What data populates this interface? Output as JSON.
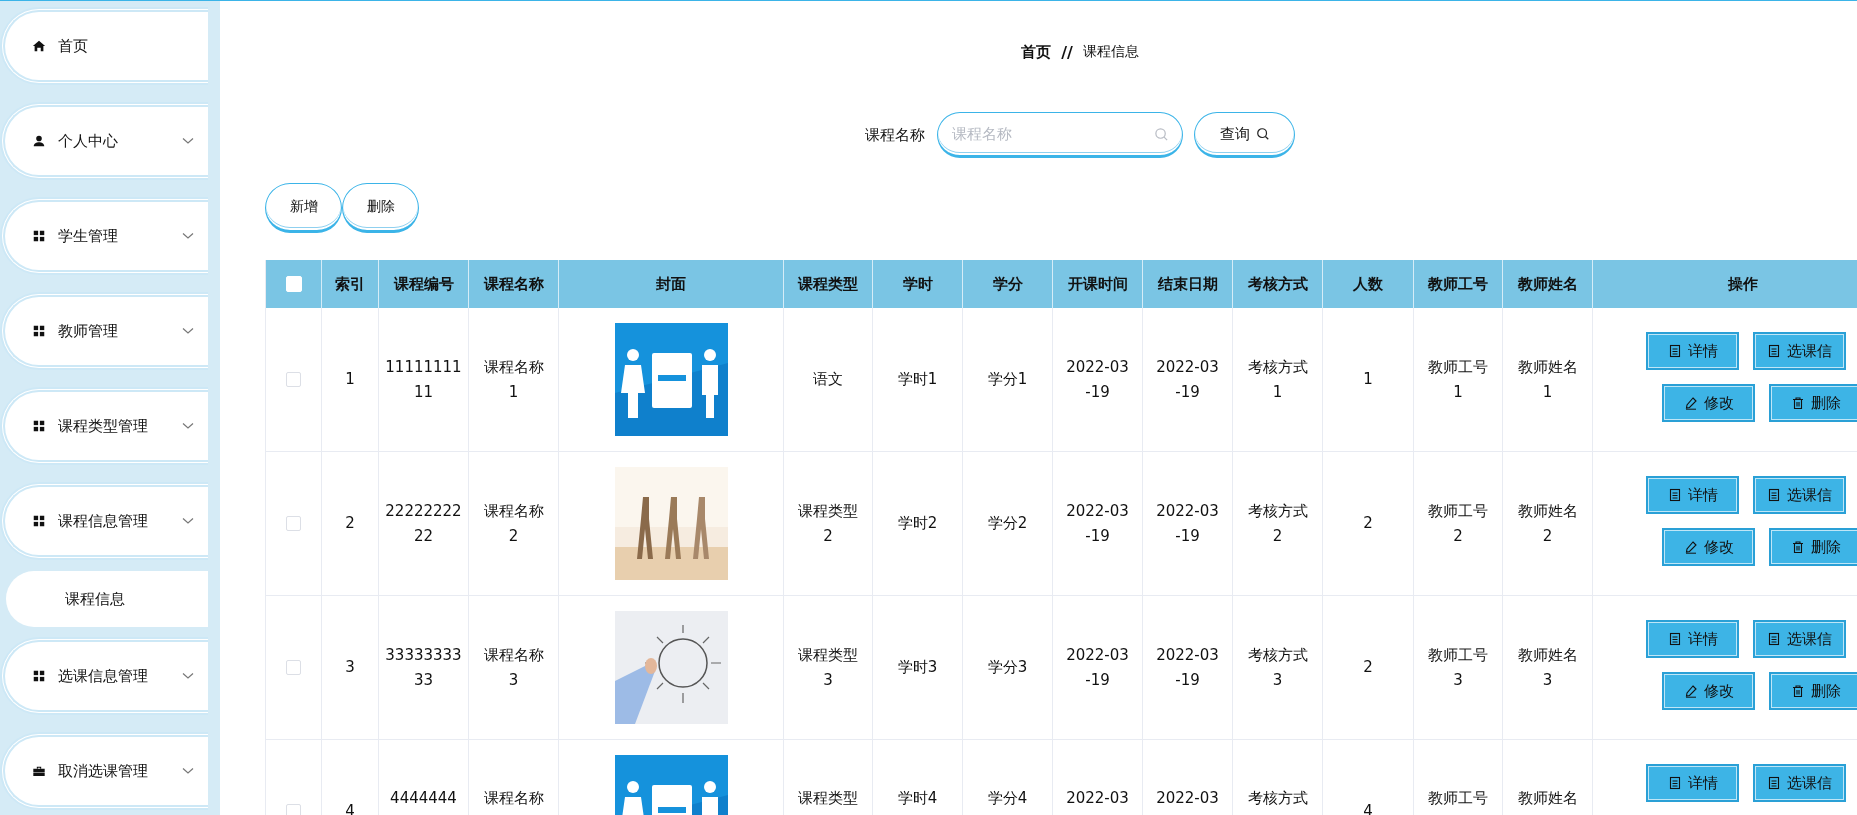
{
  "sidebar": {
    "items": [
      {
        "label": "首页",
        "kind": "link"
      },
      {
        "label": "个人中心",
        "kind": "menu"
      },
      {
        "label": "学生管理",
        "kind": "menu"
      },
      {
        "label": "教师管理",
        "kind": "menu"
      },
      {
        "label": "课程类型管理",
        "kind": "menu"
      },
      {
        "label": "课程信息管理",
        "kind": "menu",
        "children": [
          {
            "label": "课程信息"
          }
        ]
      },
      {
        "label": "选课信息管理",
        "kind": "menu"
      },
      {
        "label": "取消选课管理",
        "kind": "menu"
      }
    ]
  },
  "breadcrumb": {
    "items": [
      "首页",
      "课程信息"
    ],
    "separator": "//"
  },
  "search": {
    "label": "课程名称",
    "placeholder": "课程名称",
    "button": "查询"
  },
  "actions": [
    "新增",
    "删除"
  ],
  "table": {
    "select_all": {
      "checked": false
    },
    "columns": [
      "索引",
      "课程编号",
      "课程名称",
      "封面",
      "课程类型",
      "学时",
      "学分",
      "开课时间",
      "结束日期",
      "考核方式",
      "人数",
      "教师工号",
      "教师姓名",
      "操作"
    ],
    "rows": [
      {
        "checked": false,
        "index": "1",
        "code": "1111111111",
        "name": "课程名称1",
        "type": "语文",
        "hours": "学时1",
        "credits": "学分1",
        "start": "2022-03-19",
        "end": "2022-03-19",
        "exam": "考核方式1",
        "count": "1",
        "teacher_no": "教师工号1",
        "teacher_name": "教师姓名1",
        "buttons": [
          "详情",
          "选课信",
          "修改",
          "删除"
        ]
      },
      {
        "checked": false,
        "index": "2",
        "code": "2222222222",
        "name": "课程名称2",
        "type": "课程类型2",
        "hours": "学时2",
        "credits": "学分2",
        "start": "2022-03-19",
        "end": "2022-03-19",
        "exam": "考核方式2",
        "count": "2",
        "teacher_no": "教师工号2",
        "teacher_name": "教师姓名2",
        "buttons": [
          "详情",
          "选课信",
          "修改",
          "删除"
        ]
      },
      {
        "checked": false,
        "index": "3",
        "code": "3333333333",
        "name": "课程名称3",
        "type": "课程类型3",
        "hours": "学时3",
        "credits": "学分3",
        "start": "2022-03-19",
        "end": "2022-03-19",
        "exam": "考核方式3",
        "count": "2",
        "teacher_no": "教师工号3",
        "teacher_name": "教师姓名3",
        "buttons": [
          "详情",
          "选课信",
          "修改",
          "删除"
        ]
      },
      {
        "checked": false,
        "index": "4",
        "code": "4444444",
        "name": "课程名称",
        "type": "课程类型",
        "hours": "学时4",
        "credits": "学分4",
        "start": "2022-03",
        "end": "2022-03",
        "exam": "考核方式",
        "count": "4",
        "teacher_no": "教师工号",
        "teacher_name": "教师姓名",
        "buttons": [
          "详情",
          "选课信"
        ]
      }
    ]
  }
}
